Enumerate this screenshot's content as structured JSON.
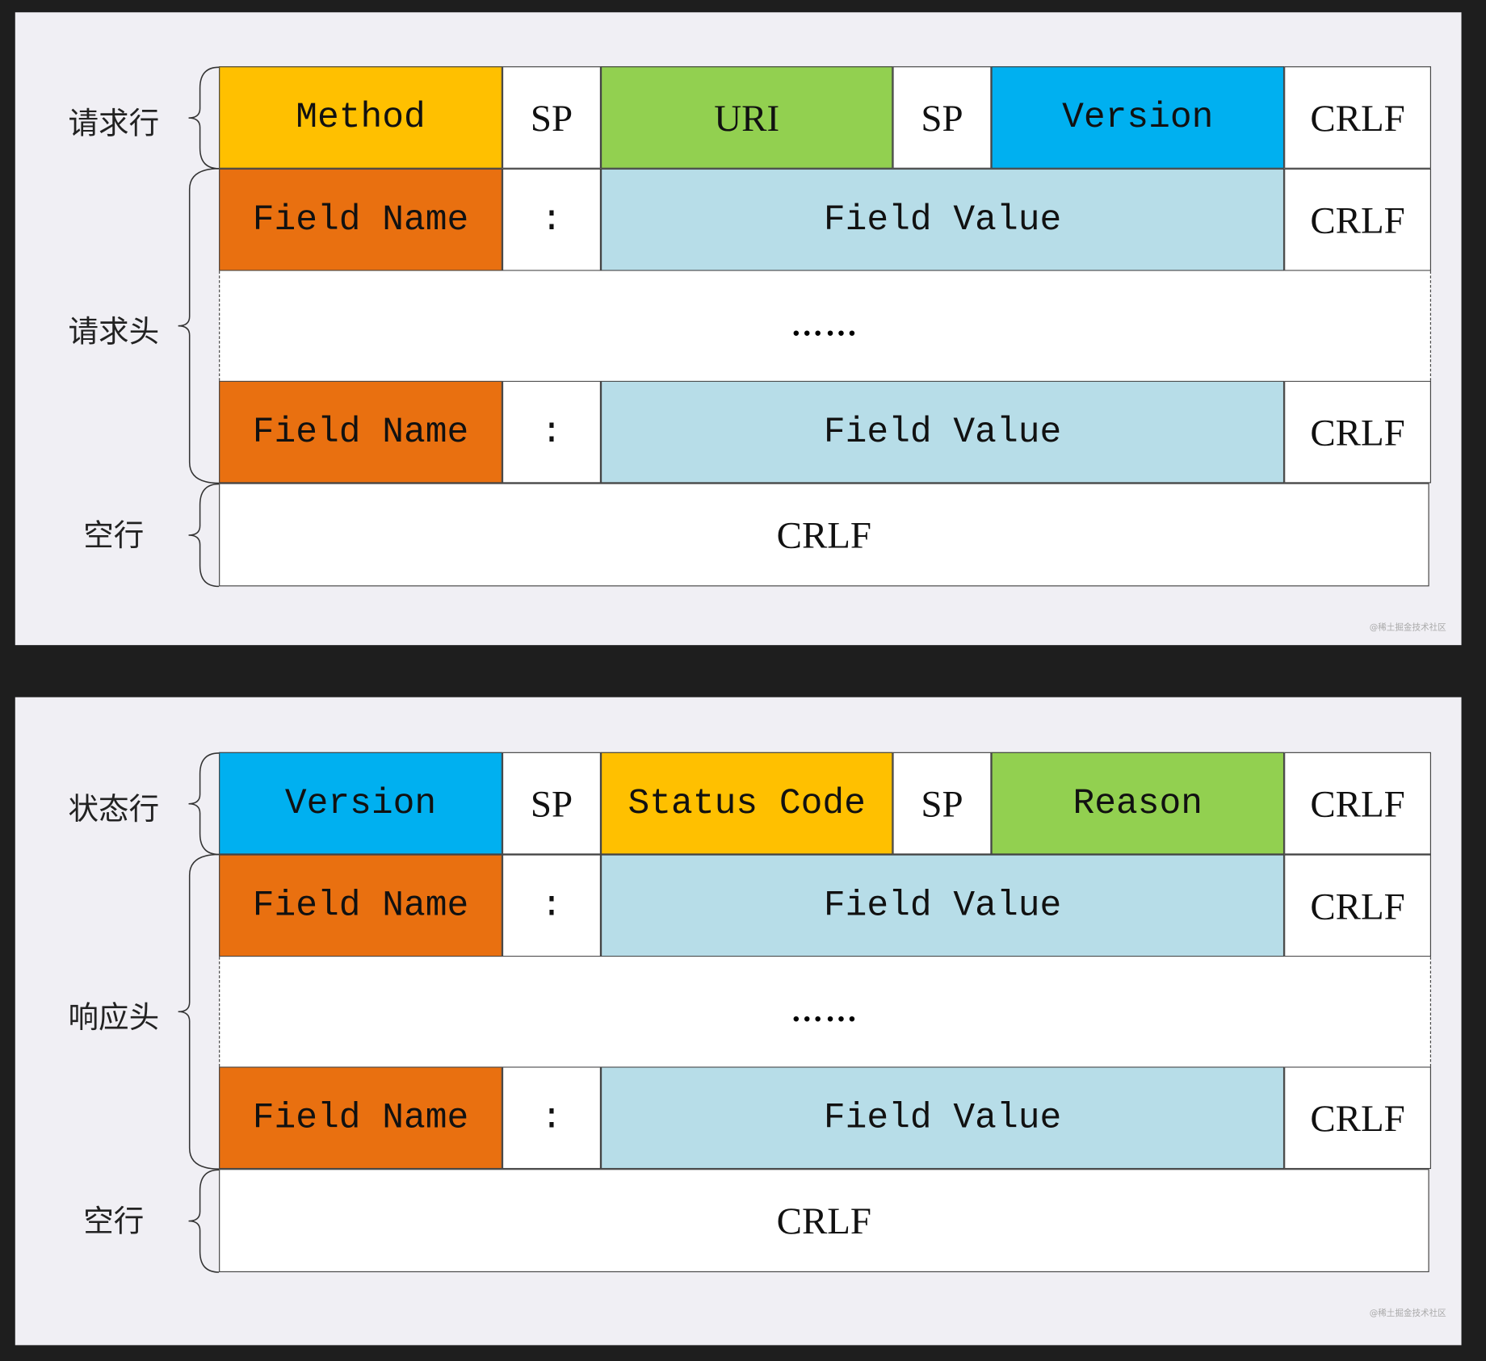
{
  "request": {
    "labels": {
      "line": "请求行",
      "headers": "请求头",
      "blank": "空行"
    },
    "start_line": [
      "Method",
      "SP",
      "URI",
      "SP",
      "Version",
      "CRLF"
    ],
    "header": {
      "name": "Field Name",
      "colon": ":",
      "value": "Field Value",
      "crlf": "CRLF"
    },
    "ellipsis": "……",
    "blank_line": "CRLF",
    "watermark": "@稀土掘金技术社区"
  },
  "response": {
    "labels": {
      "line": "状态行",
      "headers": "响应头",
      "blank": "空行"
    },
    "start_line": [
      "Version",
      "SP",
      "Status Code",
      "SP",
      "Reason",
      "CRLF"
    ],
    "header": {
      "name": "Field Name",
      "colon": ":",
      "value": "Field Value",
      "crlf": "CRLF"
    },
    "ellipsis": "……",
    "blank_line": "CRLF",
    "watermark": "@稀土掘金技术社区"
  },
  "colors": {
    "yellow": "#ffc000",
    "green": "#92d050",
    "blue": "#00b0f0",
    "orange": "#e97010",
    "light_blue": "#b7dde8"
  }
}
